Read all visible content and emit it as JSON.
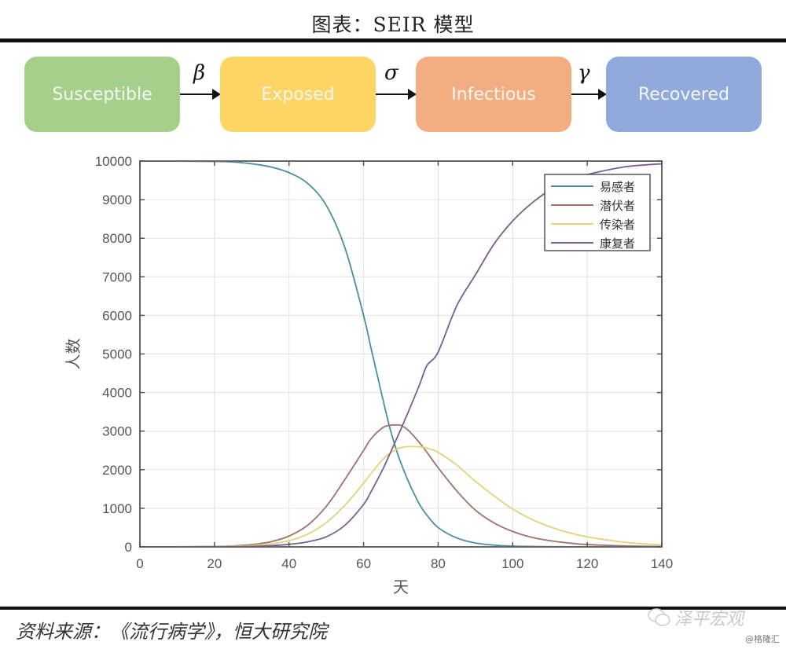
{
  "header": {
    "title": "图表：SEIR 模型"
  },
  "flow": {
    "stages": [
      {
        "label": "Susceptible",
        "color": "#a6cf8c"
      },
      {
        "label": "Exposed",
        "color": "#fdd565"
      },
      {
        "label": "Infectious",
        "color": "#f2ad80"
      },
      {
        "label": "Recovered",
        "color": "#8fa9db"
      }
    ],
    "rates": [
      "β",
      "σ",
      "γ"
    ]
  },
  "footer": {
    "source": "资料来源：《流行病学》，恒大研究院",
    "watermark": "泽平宏观",
    "watermark_sub": "@格隆汇"
  },
  "chart_data": {
    "type": "line",
    "title": "",
    "xlabel": "天",
    "ylabel": "人数",
    "xlim": [
      0,
      140
    ],
    "ylim": [
      0,
      10000
    ],
    "xticks": [
      0,
      20,
      40,
      60,
      80,
      100,
      120,
      140
    ],
    "yticks": [
      0,
      1000,
      2000,
      3000,
      4000,
      5000,
      6000,
      7000,
      8000,
      9000,
      10000
    ],
    "grid": true,
    "legend_position": "top-right",
    "x": [
      0,
      10,
      20,
      25,
      30,
      35,
      40,
      45,
      50,
      55,
      60,
      62,
      65,
      67,
      69,
      70,
      72,
      75,
      77,
      80,
      85,
      90,
      95,
      100,
      105,
      110,
      115,
      120,
      130,
      140
    ],
    "series": [
      {
        "name": "易感者",
        "color": "#4a8fa0",
        "values": [
          10000,
          9998,
          9990,
          9975,
          9930,
          9850,
          9700,
          9420,
          8850,
          7750,
          6000,
          5150,
          3900,
          3100,
          2450,
          2180,
          1700,
          1100,
          820,
          500,
          230,
          100,
          45,
          20,
          10,
          5,
          3,
          2,
          1,
          0
        ]
      },
      {
        "name": "潜伏者",
        "color": "#a0726a",
        "values": [
          0,
          2,
          10,
          25,
          60,
          130,
          280,
          560,
          1050,
          1750,
          2500,
          2800,
          3080,
          3150,
          3160,
          3150,
          3020,
          2700,
          2450,
          2050,
          1450,
          950,
          620,
          400,
          250,
          160,
          100,
          60,
          25,
          10
        ]
      },
      {
        "name": "传染者",
        "color": "#e3d27a",
        "values": [
          0,
          1,
          5,
          15,
          35,
          75,
          160,
          330,
          630,
          1080,
          1650,
          1900,
          2250,
          2420,
          2540,
          2570,
          2600,
          2590,
          2560,
          2450,
          2120,
          1700,
          1320,
          980,
          720,
          520,
          370,
          260,
          120,
          50
        ]
      },
      {
        "name": "康复者",
        "color": "#7a5f8e",
        "values": [
          0,
          0,
          2,
          5,
          12,
          30,
          65,
          130,
          260,
          560,
          1100,
          1430,
          1980,
          2400,
          2830,
          3050,
          3500,
          4200,
          4700,
          5050,
          6250,
          7050,
          7850,
          8450,
          8900,
          9250,
          9500,
          9650,
          9850,
          9930
        ]
      }
    ]
  }
}
